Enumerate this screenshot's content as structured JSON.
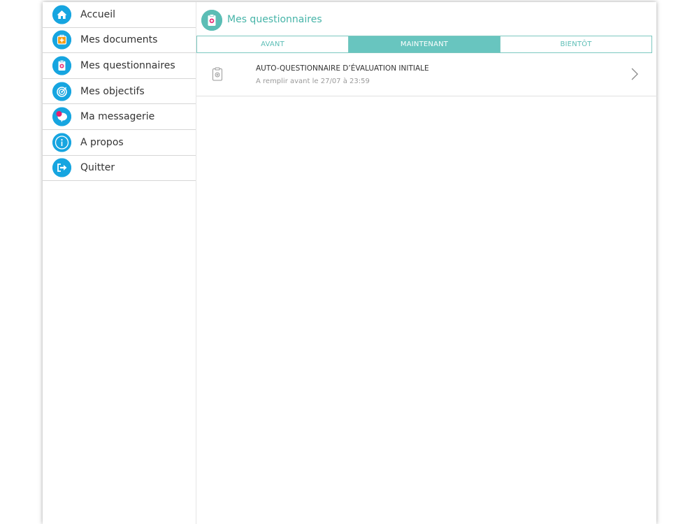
{
  "sidebar": {
    "items": [
      {
        "label": "Accueil",
        "icon": "home-icon"
      },
      {
        "label": "Mes documents",
        "icon": "medical-case-icon"
      },
      {
        "label": "Mes questionnaires",
        "icon": "clipboard-icon"
      },
      {
        "label": "Mes objectifs",
        "icon": "target-icon"
      },
      {
        "label": "Ma messagerie",
        "icon": "chat-bubble-icon"
      },
      {
        "label": "A propos",
        "icon": "info-icon"
      },
      {
        "label": "Quitter",
        "icon": "logout-icon"
      }
    ]
  },
  "header": {
    "title": "Mes questionnaires",
    "icon": "clipboard-icon"
  },
  "tabs": [
    {
      "label": "AVANT",
      "active": false
    },
    {
      "label": "MAINTENANT",
      "active": true
    },
    {
      "label": "BIENTÔT",
      "active": false
    }
  ],
  "questionnaires": [
    {
      "title": "AUTO-QUESTIONNAIRE D’ÉVALUATION INITIALE",
      "subtitle": "A remplir avant le 27/07 à 23:59",
      "icon": "clipboard-icon"
    }
  ],
  "colors": {
    "sidebar_icon_bg": "#16a5e0",
    "accent_teal": "#68c5bf",
    "header_title": "#46b4a8",
    "icon_pink": "#e3206e",
    "icon_orange": "#f39c12"
  }
}
